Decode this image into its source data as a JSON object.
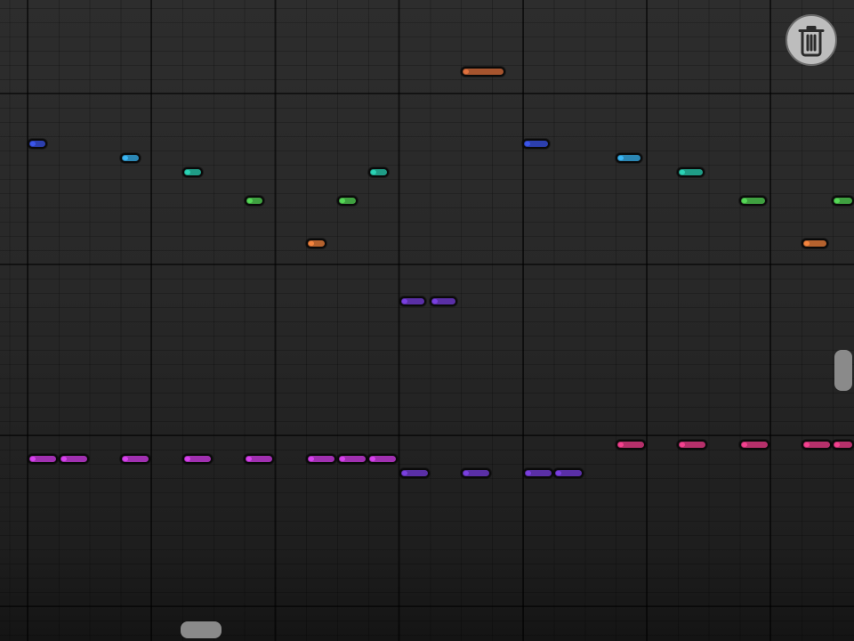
{
  "colors": {
    "background": "#2a2a2a",
    "control_gray": "#8a8a8a",
    "trash_bg": "#bdbdbd",
    "trash_icon": "#2b2b2b"
  },
  "icons": {
    "trash": "trash-icon"
  },
  "notes": [
    {
      "color": "#a6542e",
      "x": 0.0,
      "y": 0
    },
    {
      "color": "#2c3fae",
      "x": 0.0,
      "y": 0
    },
    {
      "color": "#2b86b3",
      "x": 0.0,
      "y": 0
    },
    {
      "color": "#1f9c86",
      "x": 0.0,
      "y": 0
    }
  ]
}
